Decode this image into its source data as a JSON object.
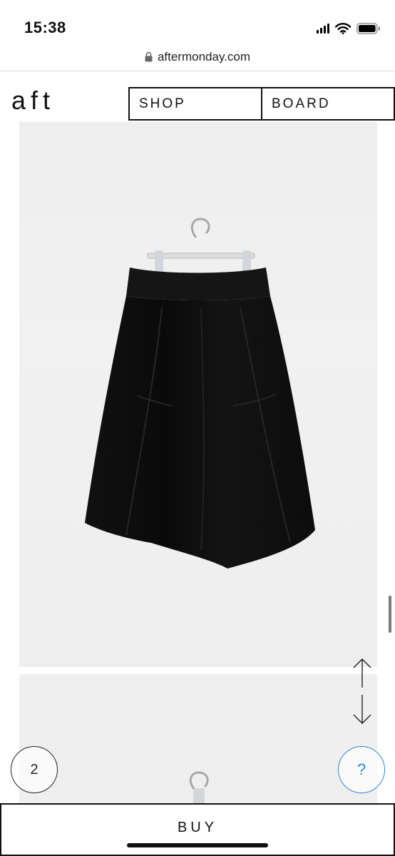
{
  "status_bar": {
    "time": "15:38",
    "icons": [
      "cellular-signal-icon",
      "wifi-icon",
      "battery-icon"
    ]
  },
  "url_bar": {
    "domain": "aftermonday.com",
    "icon": "lock-icon"
  },
  "header": {
    "logo": "aft",
    "nav": [
      {
        "label": "SHOP"
      },
      {
        "label": "BOARD"
      }
    ]
  },
  "product": {
    "images": [
      {
        "subject": "black-midi-skirt-on-hanger"
      },
      {
        "subject": "hanger-top"
      }
    ]
  },
  "floating": {
    "count": "2",
    "help": "?",
    "scroll_arrows_icon": "up-down-arrows-icon"
  },
  "buy_bar": {
    "label": "BUY"
  },
  "colors": {
    "text": "#111111",
    "photo_background": "#efefef",
    "skirt": "#0d0d0d",
    "help_accent": "#2a8ae0"
  }
}
